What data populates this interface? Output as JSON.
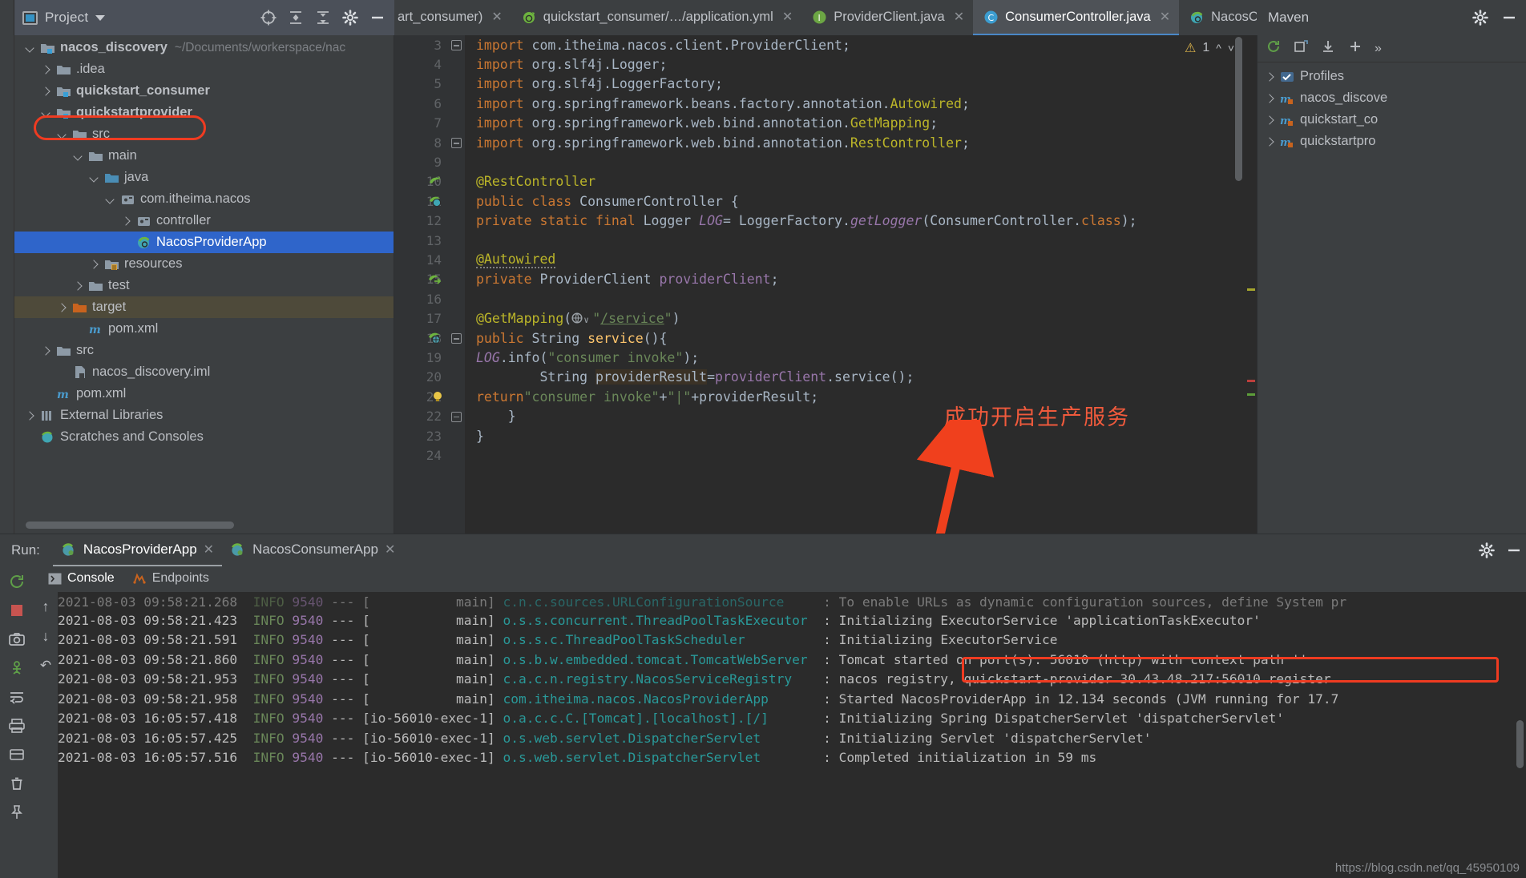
{
  "project_panel": {
    "title": "Project",
    "tree": [
      {
        "depth": 0,
        "chev": "down",
        "icon": "module-folder",
        "label": "nacos_discovery",
        "bold": true,
        "path": "~/Documents/workerspace/nac"
      },
      {
        "depth": 1,
        "chev": "right",
        "icon": "folder",
        "label": ".idea",
        "bold": false
      },
      {
        "depth": 1,
        "chev": "right",
        "icon": "module-folder",
        "label": "quickstart_consumer",
        "bold": true
      },
      {
        "depth": 1,
        "chev": "down",
        "icon": "module-folder",
        "label": "quickstartprovider",
        "bold": true,
        "highlight_box": true
      },
      {
        "depth": 2,
        "chev": "down",
        "icon": "folder",
        "label": "src",
        "bold": false
      },
      {
        "depth": 3,
        "chev": "down",
        "icon": "folder",
        "label": "main",
        "bold": false
      },
      {
        "depth": 4,
        "chev": "down",
        "icon": "source-folder",
        "label": "java",
        "bold": false
      },
      {
        "depth": 5,
        "chev": "down",
        "icon": "package",
        "label": "com.itheima.nacos",
        "bold": false
      },
      {
        "depth": 6,
        "chev": "right",
        "icon": "package",
        "label": "controller",
        "bold": false
      },
      {
        "depth": 6,
        "chev": "none",
        "icon": "spring-class",
        "label": "NacosProviderApp",
        "bold": false,
        "selected": true
      },
      {
        "depth": 4,
        "chev": "right",
        "icon": "resources-folder",
        "label": "resources",
        "bold": false
      },
      {
        "depth": 3,
        "chev": "right",
        "icon": "folder",
        "label": "test",
        "bold": false
      },
      {
        "depth": 2,
        "chev": "right",
        "icon": "target-folder",
        "label": "target",
        "bold": false,
        "dimmed_row": true
      },
      {
        "depth": 3,
        "chev": "none",
        "icon": "maven",
        "label": "pom.xml",
        "bold": false
      },
      {
        "depth": 1,
        "chev": "right",
        "icon": "folder",
        "label": "src",
        "bold": false
      },
      {
        "depth": 2,
        "chev": "none",
        "icon": "iml",
        "label": "nacos_discovery.iml",
        "bold": false
      },
      {
        "depth": 1,
        "chev": "none",
        "icon": "maven",
        "label": "pom.xml",
        "bold": false
      },
      {
        "depth": 0,
        "chev": "right",
        "icon": "libraries",
        "label": "External Libraries",
        "bold": false
      },
      {
        "depth": 0,
        "chev": "none",
        "icon": "scratches",
        "label": "Scratches and Consoles",
        "bold": false
      }
    ]
  },
  "editor_tabs": [
    {
      "label": "art_consumer)",
      "icon": "none",
      "active": false,
      "clipped": true
    },
    {
      "label": "quickstart_consumer/…/application.yml",
      "icon": "spring-yaml",
      "active": false
    },
    {
      "label": "ProviderClient.java",
      "icon": "interface",
      "active": false
    },
    {
      "label": "ConsumerController.java",
      "icon": "class",
      "active": true
    },
    {
      "label": "NacosConsumerApp.java",
      "icon": "spring-class",
      "active": false
    }
  ],
  "editor": {
    "warning_count": "1",
    "first_line_number": 3,
    "lines": [
      {
        "n": 3,
        "html": "<span class=\"kw\">import</span> com.itheima.nacos.client.ProviderClient;",
        "fold": "start"
      },
      {
        "n": 4,
        "html": "<span class=\"kw\">import</span> org.slf4j.Logger;"
      },
      {
        "n": 5,
        "html": "<span class=\"kw\">import</span> org.slf4j.LoggerFactory;"
      },
      {
        "n": 6,
        "html": "<span class=\"kw\">import</span> org.springframework.beans.factory.annotation.<span class=\"ann\">Autowired</span>;"
      },
      {
        "n": 7,
        "html": "<span class=\"kw\">import</span> org.springframework.web.bind.annotation.<span class=\"ann\">GetMapping</span>;"
      },
      {
        "n": 8,
        "html": "<span class=\"kw\">import</span> org.springframework.web.bind.annotation.<span class=\"ann\">RestController</span>;",
        "fold": "end"
      },
      {
        "n": 9,
        "html": ""
      },
      {
        "n": 10,
        "html": "<span class=\"ann\">@RestController</span>",
        "gicon": "spring-bean"
      },
      {
        "n": 11,
        "html": "<span class=\"kw\">public class</span> ConsumerController {",
        "gicon": "spring-bean-run"
      },
      {
        "n": 12,
        "html": "    <span class=\"kw\">private static final</span> Logger <span class=\"stat\">LOG</span>= LoggerFactory.<span class=\"stat\">getLogger</span>(ConsumerController.<span class=\"kw\">class</span>);"
      },
      {
        "n": 13,
        "html": ""
      },
      {
        "n": 14,
        "html": "    <span class=\"ann wavy\">@Autowired</span>"
      },
      {
        "n": 15,
        "html": "    <span class=\"kw\">private</span> ProviderClient <span class=\"fld\">providerClient</span>;",
        "gicon": "bean-arrow"
      },
      {
        "n": 16,
        "html": ""
      },
      {
        "n": 17,
        "html": "    <span class=\"ann\">@GetMapping</span>(<span class=\"gm-icon\"></span><span class=\"str\">\"</span><span class=\"underline-str\">/service</span><span class=\"str\">\"</span>)"
      },
      {
        "n": 18,
        "html": "    <span class=\"kw\">public</span> String <span class=\"mth\">service</span>(){",
        "gicon": "web-run",
        "fold": "start"
      },
      {
        "n": 19,
        "html": "        <span class=\"stat\">LOG</span>.info(<span class=\"str\">\"consumer invoke\"</span>);"
      },
      {
        "n": 20,
        "html": "        String <span class=\"hl-ident\">providerResult</span>=<span class=\"fld\">providerClient</span>.service();"
      },
      {
        "n": 21,
        "html": "        <span class=\"kw\">return</span> <span class=\"str\">\"consumer invoke\"</span>+<span class=\"str\">\"|\"</span>+providerResult;",
        "bulb": true
      },
      {
        "n": 22,
        "html": "    }",
        "fold": "end"
      },
      {
        "n": 23,
        "html": "}"
      },
      {
        "n": 24,
        "html": ""
      }
    ]
  },
  "annotation": {
    "text": "成功开启生产服务",
    "color": "#f05a3c"
  },
  "maven_panel": {
    "title": "Maven",
    "items": [
      {
        "label": "Profiles",
        "icon": "profiles",
        "chev": "right"
      },
      {
        "label": "nacos_discove",
        "icon": "maven-module",
        "chev": "right"
      },
      {
        "label": "quickstart_co",
        "icon": "maven-module",
        "chev": "right"
      },
      {
        "label": "quickstartpro",
        "icon": "maven-module",
        "chev": "right"
      }
    ]
  },
  "run_panel": {
    "run_label": "Run:",
    "tabs": [
      {
        "label": "NacosProviderApp",
        "active": true
      },
      {
        "label": "NacosConsumerApp",
        "active": false
      }
    ],
    "subtabs": [
      {
        "label": "Console",
        "icon": "console-icon",
        "active": true
      },
      {
        "label": "Endpoints",
        "icon": "endpoints-icon",
        "active": false
      }
    ],
    "log_lines": [
      {
        "ts": "2021-08-03 09:58:21.268",
        "level": "INFO",
        "pid": "9540",
        "thread": "main",
        "logger": "c.n.c.sources.URLConfigurationSource",
        "msg": "To enable URLs as dynamic configuration sources, define System pr",
        "clipped_top": true
      },
      {
        "ts": "2021-08-03 09:58:21.423",
        "level": "INFO",
        "pid": "9540",
        "thread": "main",
        "logger": "o.s.s.concurrent.ThreadPoolTaskExecutor",
        "msg": "Initializing ExecutorService 'applicationTaskExecutor'"
      },
      {
        "ts": "2021-08-03 09:58:21.591",
        "level": "INFO",
        "pid": "9540",
        "thread": "main",
        "logger": "o.s.s.c.ThreadPoolTaskScheduler",
        "msg": "Initializing ExecutorService"
      },
      {
        "ts": "2021-08-03 09:58:21.860",
        "level": "INFO",
        "pid": "9540",
        "thread": "main",
        "logger": "o.s.b.w.embedded.tomcat.TomcatWebServer",
        "msg": "Tomcat started on port(s): 56010 (http) with context path ''",
        "highlight_box": true
      },
      {
        "ts": "2021-08-03 09:58:21.953",
        "level": "INFO",
        "pid": "9540",
        "thread": "main",
        "logger": "c.a.c.n.registry.NacosServiceRegistry",
        "msg": "nacos registry, quickstart-provider 30.43.48.217:56010 register "
      },
      {
        "ts": "2021-08-03 09:58:21.958",
        "level": "INFO",
        "pid": "9540",
        "thread": "main",
        "logger": "com.itheima.nacos.NacosProviderApp",
        "msg": "Started NacosProviderApp in 12.134 seconds (JVM running for 17.7"
      },
      {
        "ts": "2021-08-03 16:05:57.418",
        "level": "INFO",
        "pid": "9540",
        "thread": "io-56010-exec-1",
        "logger": "o.a.c.c.C.[Tomcat].[localhost].[/]",
        "msg": "Initializing Spring DispatcherServlet 'dispatcherServlet'"
      },
      {
        "ts": "2021-08-03 16:05:57.425",
        "level": "INFO",
        "pid": "9540",
        "thread": "io-56010-exec-1",
        "logger": "o.s.web.servlet.DispatcherServlet",
        "msg": "Initializing Servlet 'dispatcherServlet'"
      },
      {
        "ts": "2021-08-03 16:05:57.516",
        "level": "INFO",
        "pid": "9540",
        "thread": "io-56010-exec-1",
        "logger": "o.s.web.servlet.DispatcherServlet",
        "msg": "Completed initialization in 59 ms"
      }
    ]
  },
  "watermark": "https://blog.csdn.net/qq_45950109"
}
